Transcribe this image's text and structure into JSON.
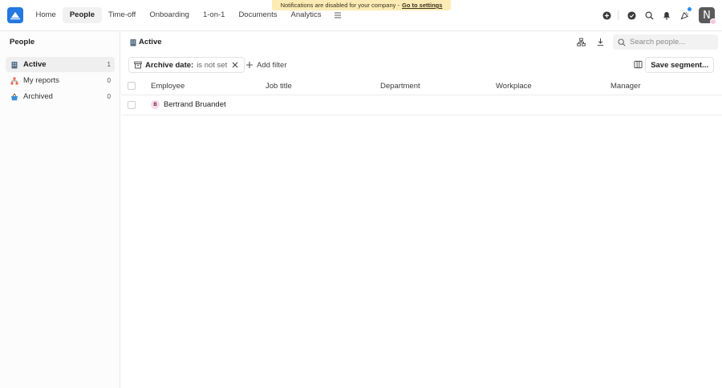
{
  "notice": {
    "text": "Notifications are disabled for your company -",
    "link": "Go to settings"
  },
  "nav": {
    "items": [
      {
        "label": "Home"
      },
      {
        "label": "People"
      },
      {
        "label": "Time-off"
      },
      {
        "label": "Onboarding"
      },
      {
        "label": "1-on-1"
      },
      {
        "label": "Documents"
      },
      {
        "label": "Analytics"
      }
    ],
    "active": "People"
  },
  "user": {
    "initial": "N"
  },
  "sidebar": {
    "title": "People",
    "items": [
      {
        "label": "Active",
        "count": "1",
        "icon": "building-icon"
      },
      {
        "label": "My reports",
        "count": "0",
        "icon": "org-chart-icon"
      },
      {
        "label": "Archived",
        "count": "0",
        "icon": "archive-basket-icon"
      }
    ]
  },
  "main": {
    "breadcrumb": "Active",
    "search_placeholder": "Search people...",
    "filter": {
      "key": "Archive date:",
      "value": "is not set"
    },
    "add_filter": "Add filter",
    "save_segment": "Save segment..."
  },
  "table": {
    "columns": [
      "Employee",
      "Job title",
      "Department",
      "Workplace",
      "Manager"
    ],
    "rows": [
      {
        "initial": "B",
        "employee": "Bertrand Bruandet",
        "job_title": "",
        "department": "",
        "workplace": "",
        "manager": ""
      }
    ]
  },
  "colors": {
    "brand": "#2479e1",
    "notice_bg": "#fcebb4",
    "badge": "#2b8df0"
  }
}
